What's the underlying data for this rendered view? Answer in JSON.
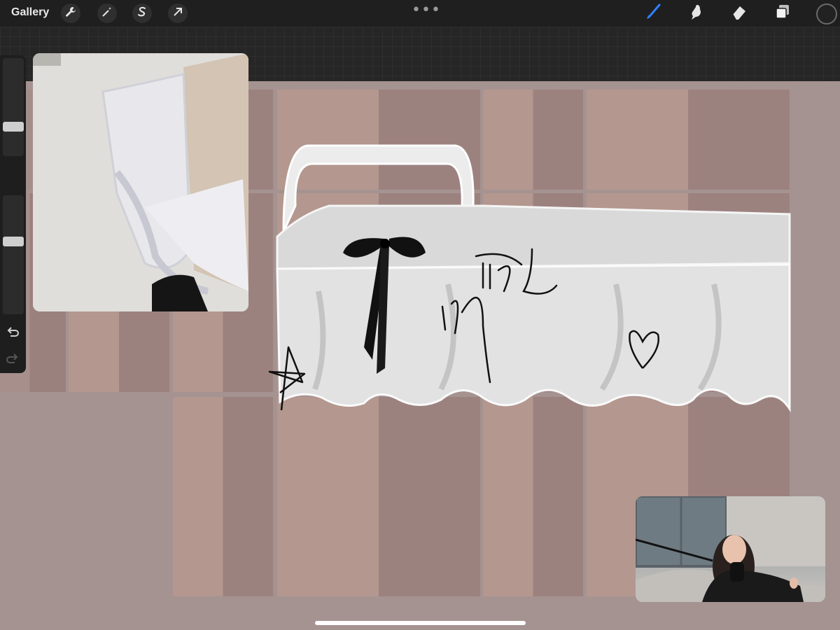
{
  "toolbar": {
    "gallery_label": "Gallery",
    "left_tools": [
      "wrench-icon",
      "magic-wand-icon",
      "selection-s-icon",
      "transform-arrow-icon"
    ],
    "more_label": "•••",
    "right_tools": [
      "brush-icon",
      "smudge-icon",
      "eraser-icon",
      "layers-icon"
    ],
    "active_tool": "brush-icon",
    "active_color": "#2f80ff",
    "current_color": "#222222"
  },
  "sidebar": {
    "brush_size_level": 0.28,
    "opacity_level": 0.62,
    "undo_icon": "undo-icon",
    "redo_icon": "redo-icon"
  },
  "canvas": {
    "background_color": "#a59391",
    "stripe_color_light": "#b4978f",
    "stripe_color_dark": "#9c827f",
    "garment_color": "#e8e8e8",
    "bow_color": "#111111"
  },
  "reference_window": {
    "content": "reference-photo"
  },
  "video_overlay": {
    "content": "presenter-webcam"
  }
}
